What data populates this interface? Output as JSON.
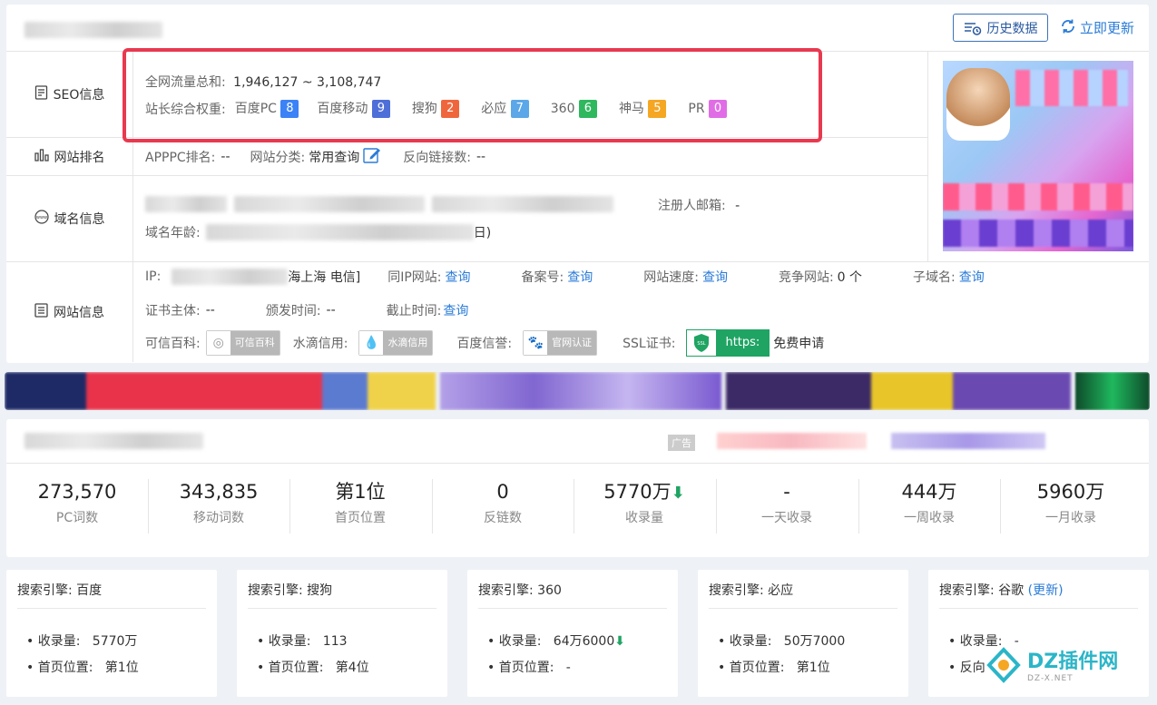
{
  "header": {
    "history_btn": "历史数据",
    "refresh_btn": "立即更新"
  },
  "seo": {
    "row_label": "SEO信息",
    "traffic_label": "全网流量总和:",
    "traffic_value": "1,946,127 ~ 3,108,747",
    "weight_label": "站长综合权重:",
    "weights": [
      {
        "name": "百度PC",
        "value": "8",
        "color": "#3b82f6"
      },
      {
        "name": "百度移动",
        "value": "9",
        "color": "#4f6fd8"
      },
      {
        "name": "搜狗",
        "value": "2",
        "color": "#f0663c"
      },
      {
        "name": "必应",
        "value": "7",
        "color": "#5ba7e8"
      },
      {
        "name": "360",
        "value": "6",
        "color": "#2fb85e"
      },
      {
        "name": "神马",
        "value": "5",
        "color": "#f5a623"
      },
      {
        "name": "PR",
        "value": "0",
        "color": "#e06de6"
      }
    ]
  },
  "rank": {
    "row_label": "网站排名",
    "apppc_label": "APPPC排名:",
    "apppc_value": "--",
    "category_label": "网站分类:",
    "category_value": "常用查询",
    "backlinks_label": "反向链接数:",
    "backlinks_value": "--"
  },
  "domain": {
    "row_label": "域名信息",
    "email_label": "注册人邮箱:",
    "email_value": "-",
    "age_label": "域名年龄:",
    "age_tail": "日)"
  },
  "site": {
    "row_label": "网站信息",
    "ip_label": "IP:",
    "ip_tail": "海上海 电信]",
    "sameip_label": "同IP网站:",
    "sameip_link": "查询",
    "icp_label": "备案号:",
    "icp_link": "查询",
    "speed_label": "网站速度:",
    "speed_link": "查询",
    "compete_label": "竞争网站:",
    "compete_value": "0 个",
    "subdomain_label": "子域名:",
    "subdomain_link": "查询",
    "cert_subject_label": "证书主体:",
    "cert_subject_value": "--",
    "issue_label": "颁发时间:",
    "issue_value": "--",
    "expire_label": "截止时间:",
    "expire_link": "查询",
    "kexin_label": "可信百科:",
    "kexin_badge": "可信百科",
    "shuidi_label": "水滴信用:",
    "shuidi_badge": "水滴信用",
    "baidu_label": "百度信誉:",
    "baidu_badge": "官网认证",
    "ssl_label": "SSL证书:",
    "ssl_icon_text": "SSL",
    "ssl_badge": "https:",
    "ssl_apply": "免费申请"
  },
  "ad_tag": "广告",
  "stats": [
    {
      "value": "273,570",
      "label": "PC词数"
    },
    {
      "value": "343,835",
      "label": "移动词数"
    },
    {
      "value": "第1位",
      "label": "首页位置"
    },
    {
      "value": "0",
      "label": "反链数"
    },
    {
      "value": "5770万",
      "label": "收录量",
      "arrow": "down"
    },
    {
      "value": "-",
      "label": "一天收录"
    },
    {
      "value": "444万",
      "label": "一周收录"
    },
    {
      "value": "5960万",
      "label": "一月收录"
    }
  ],
  "engines": [
    {
      "title": "搜索引擎: 百度",
      "index_label": "收录量:",
      "index_value": "5770万",
      "pos_label": "首页位置:",
      "pos_value": "第1位"
    },
    {
      "title": "搜索引擎: 搜狗",
      "index_label": "收录量:",
      "index_value": "113",
      "pos_label": "首页位置:",
      "pos_value": "第4位"
    },
    {
      "title": "搜索引擎: 360",
      "index_label": "收录量:",
      "index_value": "64万6000",
      "pos_label": "首页位置:",
      "pos_value": "-"
    },
    {
      "title": "搜索引擎: 必应",
      "index_label": "收录量:",
      "index_value": "50万7000",
      "pos_label": "首页位置:",
      "pos_value": "第1位"
    },
    {
      "title": "搜索引擎: 谷歌",
      "update_link": "(更新)",
      "index_label": "收录量:",
      "index_value": "-",
      "pos_label": "反向",
      "pos_value": ""
    }
  ],
  "watermark": {
    "text": "DZ插件网",
    "sub": "DZ-X.NET"
  }
}
